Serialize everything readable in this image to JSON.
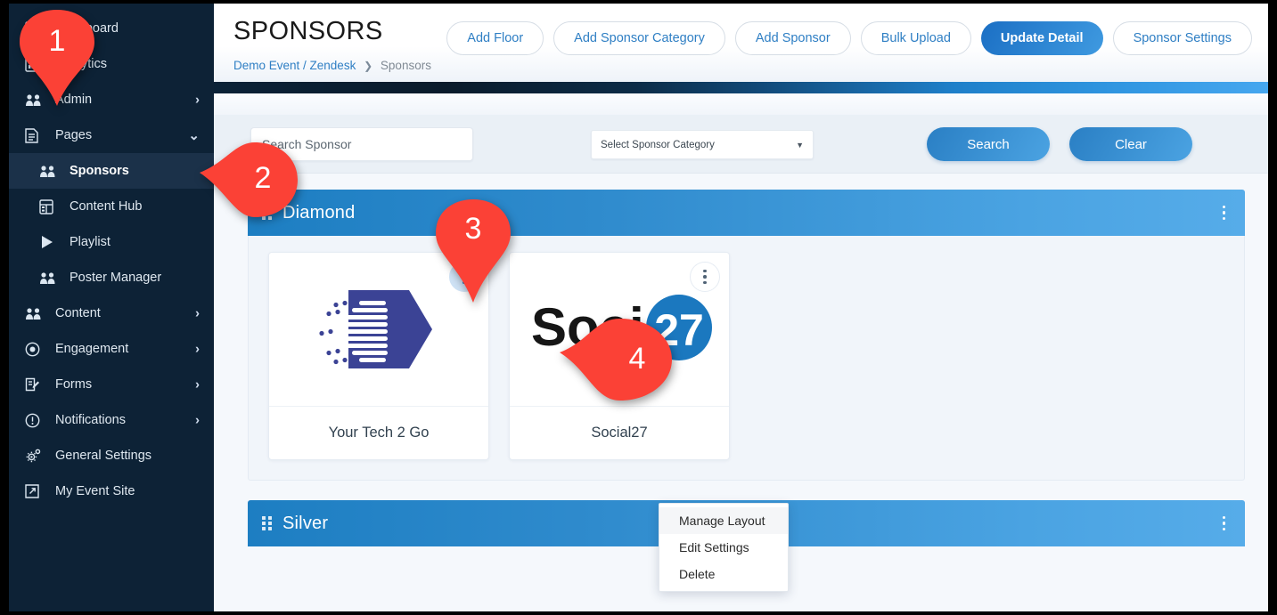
{
  "sidebar": {
    "items": [
      {
        "label": "Dashboard",
        "icon": "dashboard-icon",
        "chevron": "",
        "active": false,
        "sub": false,
        "obscured": true
      },
      {
        "label": "Analytics",
        "icon": "analytics-icon",
        "chevron": "",
        "active": false,
        "sub": false,
        "obscured": true
      },
      {
        "label": "Admin",
        "icon": "people-icon",
        "chevron": "›",
        "active": false,
        "sub": false,
        "obscured": true
      },
      {
        "label": "Pages",
        "icon": "page-icon",
        "chevron": "⌄",
        "active": false,
        "sub": false,
        "obscured": false
      },
      {
        "label": "Sponsors",
        "icon": "people-icon",
        "chevron": "",
        "active": true,
        "sub": true,
        "obscured": false
      },
      {
        "label": "Content Hub",
        "icon": "content-hub-icon",
        "chevron": "",
        "active": false,
        "sub": true,
        "obscured": false
      },
      {
        "label": "Playlist",
        "icon": "play-icon",
        "chevron": "",
        "active": false,
        "sub": true,
        "obscured": false
      },
      {
        "label": "Poster Manager",
        "icon": "people-icon",
        "chevron": "",
        "active": false,
        "sub": true,
        "obscured": false
      },
      {
        "label": "Content",
        "icon": "people-icon",
        "chevron": "›",
        "active": false,
        "sub": false,
        "obscured": false
      },
      {
        "label": "Engagement",
        "icon": "target-icon",
        "chevron": "›",
        "active": false,
        "sub": false,
        "obscured": false
      },
      {
        "label": "Forms",
        "icon": "form-edit-icon",
        "chevron": "›",
        "active": false,
        "sub": false,
        "obscured": false
      },
      {
        "label": "Notifications",
        "icon": "alert-circle-icon",
        "chevron": "›",
        "active": false,
        "sub": false,
        "obscured": false
      },
      {
        "label": "General Settings",
        "icon": "gear-icon",
        "chevron": "",
        "active": false,
        "sub": false,
        "obscured": false
      },
      {
        "label": "My Event Site",
        "icon": "external-link-icon",
        "chevron": "",
        "active": false,
        "sub": false,
        "obscured": false
      }
    ]
  },
  "header": {
    "title": "SPONSORS",
    "breadcrumb": {
      "root": "Demo Event / Zendesk",
      "separator": "❯",
      "current": "Sponsors"
    },
    "actions": [
      {
        "label": "Add Floor",
        "primary": false
      },
      {
        "label": "Add Sponsor Category",
        "primary": false
      },
      {
        "label": "Add Sponsor",
        "primary": false
      },
      {
        "label": "Bulk Upload",
        "primary": false
      },
      {
        "label": "Update Detail",
        "primary": true
      },
      {
        "label": "Sponsor Settings",
        "primary": false
      }
    ]
  },
  "search": {
    "input_placeholder": "Search Sponsor",
    "input_value": "",
    "category_placeholder": "Select Sponsor Category",
    "category_caret": "▼",
    "search_button": "Search",
    "clear_button": "Clear"
  },
  "categories": [
    {
      "name": "Diamond",
      "sponsors": [
        {
          "name": "Your Tech 2 Go",
          "logo": "your-tech-2-go-logo",
          "menu_open": true
        },
        {
          "name": "Social27",
          "logo": "social27-logo",
          "menu_open": false
        }
      ]
    },
    {
      "name": "Silver",
      "sponsors": []
    }
  ],
  "context_menu": {
    "items": [
      {
        "label": "Manage Layout",
        "highlighted": true
      },
      {
        "label": "Edit Settings",
        "highlighted": false
      },
      {
        "label": "Delete",
        "highlighted": false
      }
    ]
  },
  "markers": [
    {
      "number": "1"
    },
    {
      "number": "2"
    },
    {
      "number": "3"
    },
    {
      "number": "4"
    }
  ],
  "colors": {
    "sidebar_bg": "#0d2236",
    "accent_blue": "#2f7fc4",
    "category_header_from": "#1d7ec2",
    "category_header_to": "#56ace9",
    "marker_red": "#fb4136",
    "logo_indigo": "#3b4395",
    "logo_blue": "#1b78bf"
  }
}
